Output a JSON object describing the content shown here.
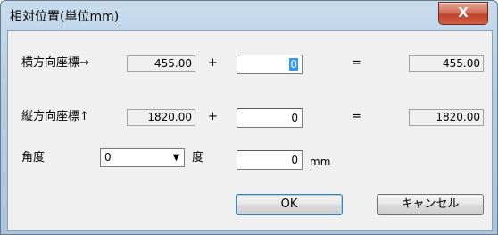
{
  "dialog": {
    "title": "相対位置(単位mm)",
    "close_label": "X"
  },
  "rows": [
    {
      "label": "横方向座標→",
      "current": "455.00",
      "plus": "+",
      "offset": "0",
      "equals": "=",
      "result": "455.00"
    },
    {
      "label": "縦方向座標↑",
      "current": "1820.00",
      "plus": "+",
      "offset": "0",
      "equals": "=",
      "result": "1820.00"
    }
  ],
  "angle": {
    "label": "角度",
    "selected": "0",
    "arrow": "▼",
    "unit_label": "度",
    "value": "0",
    "value_unit": "mm"
  },
  "buttons": {
    "ok": "OK",
    "cancel": "キャンセル"
  }
}
